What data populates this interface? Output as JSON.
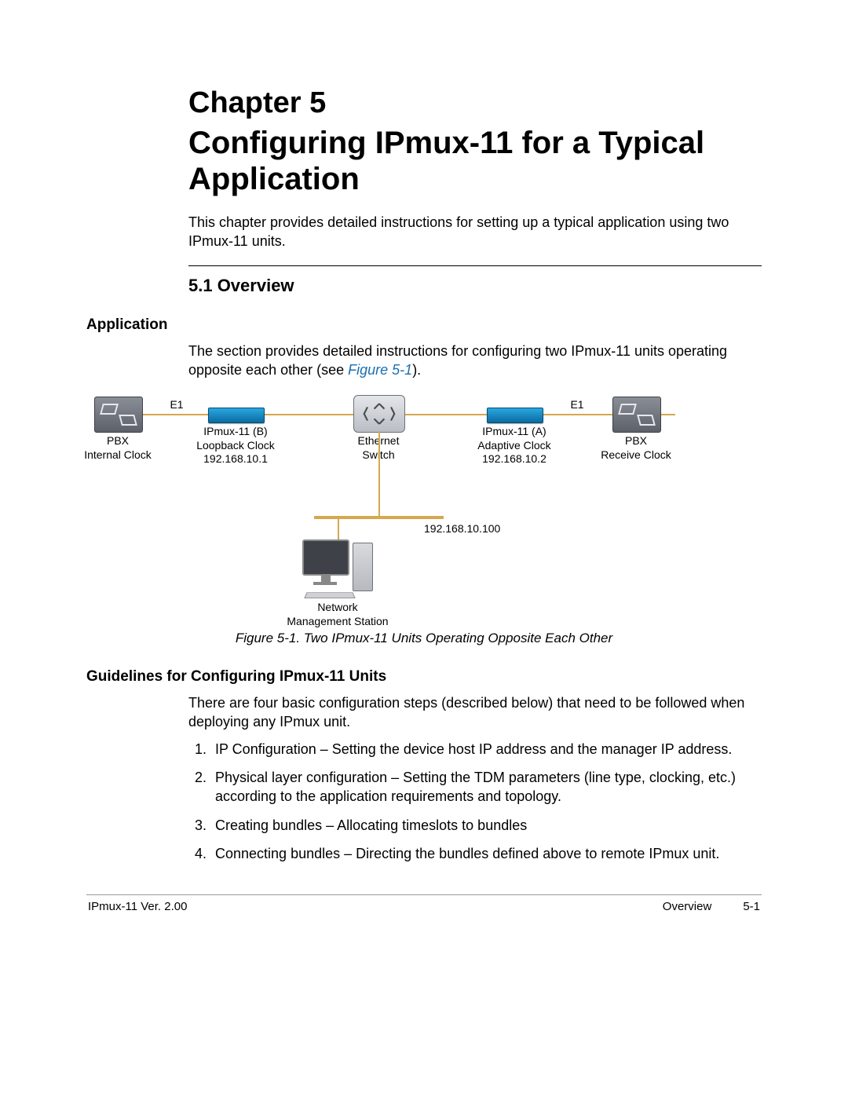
{
  "chapter": {
    "number": "Chapter 5",
    "title": "Configuring IPmux-11 for a Typical Application",
    "intro": "This chapter provides detailed instructions for setting up a typical application using two IPmux-11 units."
  },
  "section": {
    "heading": "5.1  Overview"
  },
  "application": {
    "sideHeading": "Application",
    "text_part1": "The section provides detailed instructions for configuring two IPmux-11 units operating opposite each other (see ",
    "figure_link": "Figure 5-1",
    "text_part2": ")."
  },
  "diagram": {
    "e1_left": "E1",
    "e1_right": "E1",
    "pbx_left_l1": "PBX",
    "pbx_left_l2": "Internal Clock",
    "pbx_right_l1": "PBX",
    "pbx_right_l2": "Receive Clock",
    "ipmuxB_l1": "IPmux-11 (B)",
    "ipmuxB_l2": "Loopback Clock",
    "ipmuxB_l3": "192.168.10.1",
    "ipmuxA_l1": "IPmux-11 (A)",
    "ipmuxA_l2": "Adaptive Clock",
    "ipmuxA_l3": "192.168.10.2",
    "switch_l1": "Ethernet",
    "switch_l2": "Switch",
    "nms_ip": "192.168.10.100",
    "nms_l1": "Network",
    "nms_l2": "Management Station"
  },
  "figureCaption": "Figure 5-1.  Two IPmux-11 Units Operating Opposite Each Other",
  "guidelines": {
    "heading": "Guidelines for Configuring IPmux-11 Units",
    "intro": "There are four basic configuration steps (described below) that need to be followed when deploying any IPmux unit.",
    "steps": [
      "IP Configuration – Setting the device host IP address and the manager IP address.",
      "Physical layer configuration – Setting the TDM parameters (line type, clocking, etc.) according to the application requirements and topology.",
      "Creating bundles – Allocating timeslots to bundles",
      "Connecting bundles – Directing the bundles defined above to remote IPmux unit."
    ]
  },
  "footer": {
    "left": "IPmux-11 Ver. 2.00",
    "center": "Overview",
    "page": "5-1"
  }
}
